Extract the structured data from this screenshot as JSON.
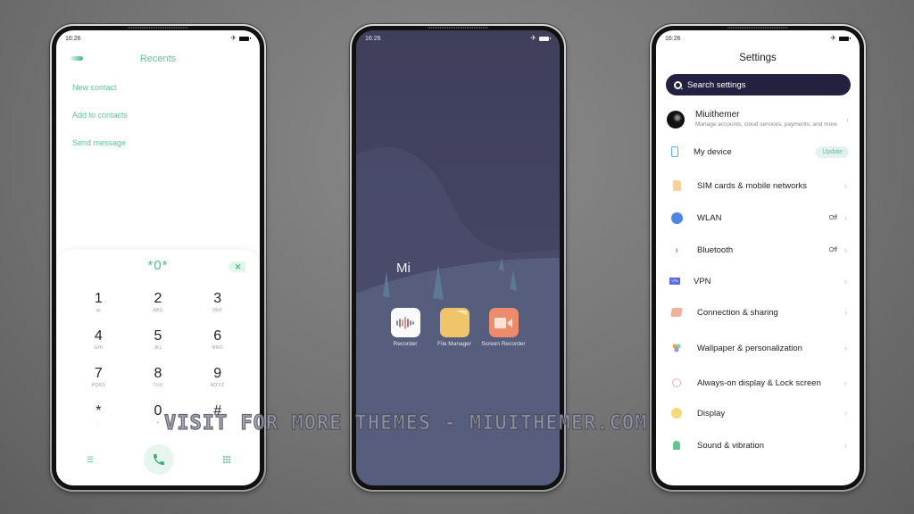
{
  "status_bar": {
    "time": "16:26"
  },
  "dialer": {
    "title": "Recents",
    "menu": [
      "New contact",
      "Add to contacts",
      "Send message"
    ],
    "dialed_number": "*0*",
    "keys": [
      {
        "digit": "1",
        "letters": "ꝏ"
      },
      {
        "digit": "2",
        "letters": "ABC"
      },
      {
        "digit": "3",
        "letters": "DEF"
      },
      {
        "digit": "4",
        "letters": "GHI"
      },
      {
        "digit": "5",
        "letters": "JKL"
      },
      {
        "digit": "6",
        "letters": "MNO"
      },
      {
        "digit": "7",
        "letters": "PQRS"
      },
      {
        "digit": "8",
        "letters": "TUV"
      },
      {
        "digit": "9",
        "letters": "WXYZ"
      },
      {
        "digit": "*",
        "letters": ","
      },
      {
        "digit": "0",
        "letters": "+"
      },
      {
        "digit": "#",
        "letters": ""
      }
    ],
    "accent_color": "#5cc491"
  },
  "home": {
    "folder_name": "Mi",
    "apps": [
      {
        "label": "Recorder",
        "icon": "recorder-icon"
      },
      {
        "label": "File Manager",
        "icon": "file-manager-icon"
      },
      {
        "label": "Screen Recorder",
        "icon": "screen-recorder-icon"
      }
    ]
  },
  "settings": {
    "title": "Settings",
    "search_placeholder": "Search settings",
    "account": {
      "name": "Miuithemer",
      "subtitle": "Manage accounts, cloud services, payments, and more"
    },
    "my_device": {
      "label": "My device",
      "badge": "Update"
    },
    "items": [
      {
        "label": "SIM cards & mobile networks",
        "value": ""
      },
      {
        "label": "WLAN",
        "value": "Off"
      },
      {
        "label": "Bluetooth",
        "value": "Off"
      },
      {
        "label": "VPN",
        "value": ""
      },
      {
        "label": "Connection & sharing",
        "value": ""
      },
      {
        "label": "Wallpaper & personalization",
        "value": ""
      },
      {
        "label": "Always-on display & Lock screen",
        "value": ""
      },
      {
        "label": "Display",
        "value": ""
      },
      {
        "label": "Sound & vibration",
        "value": ""
      }
    ],
    "vpn_icon_text": "VPN"
  },
  "watermark": "VISIT FOR MORE THEMES - MIUITHEMER.COM"
}
